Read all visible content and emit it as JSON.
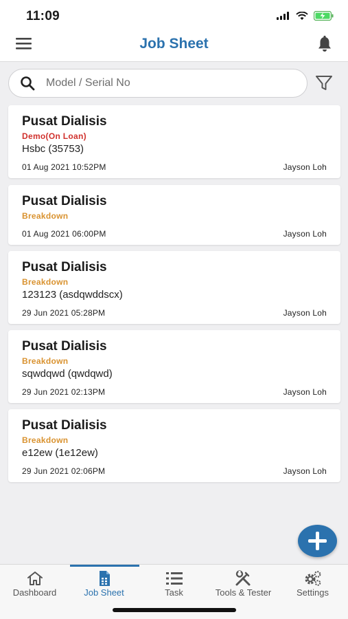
{
  "status_bar": {
    "time": "11:09"
  },
  "header": {
    "title": "Job Sheet"
  },
  "search": {
    "placeholder": "Model / Serial No"
  },
  "colors": {
    "accent": "#2b72ae",
    "status_demo": "#d0312d",
    "status_breakdown": "#d9922f"
  },
  "jobs": [
    {
      "title": "Pusat Dialisis",
      "status": "Demo(On Loan)",
      "status_kind": "demo",
      "model": "Hsbc (35753)",
      "date": "01 Aug 2021 10:52PM",
      "technician": "Jayson Loh"
    },
    {
      "title": "Pusat Dialisis",
      "status": "Breakdown",
      "status_kind": "breakdown",
      "model": "",
      "date": "01 Aug 2021 06:00PM",
      "technician": "Jayson Loh"
    },
    {
      "title": "Pusat Dialisis",
      "status": "Breakdown",
      "status_kind": "breakdown",
      "model": "123123 (asdqwddscx)",
      "date": "29 Jun 2021 05:28PM",
      "technician": "Jayson Loh"
    },
    {
      "title": "Pusat Dialisis",
      "status": "Breakdown",
      "status_kind": "breakdown",
      "model": "sqwdqwd (qwdqwd)",
      "date": "29 Jun 2021 02:13PM",
      "technician": "Jayson Loh"
    },
    {
      "title": "Pusat Dialisis",
      "status": "Breakdown",
      "status_kind": "breakdown",
      "model": "e12ew (1e12ew)",
      "date": "29 Jun 2021 02:06PM",
      "technician": "Jayson Loh"
    }
  ],
  "tabs": [
    {
      "label": "Dashboard",
      "icon": "home-icon",
      "active": false
    },
    {
      "label": "Job Sheet",
      "icon": "document-icon",
      "active": true
    },
    {
      "label": "Task",
      "icon": "list-icon",
      "active": false
    },
    {
      "label": "Tools & Tester",
      "icon": "tools-icon",
      "active": false
    },
    {
      "label": "Settings",
      "icon": "gears-icon",
      "active": false
    }
  ]
}
